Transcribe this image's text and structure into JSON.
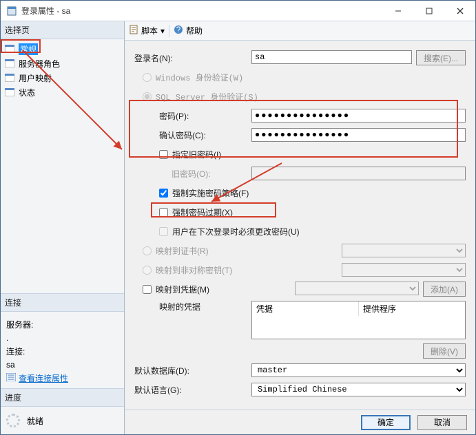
{
  "window": {
    "title": "登录属性 - sa"
  },
  "sidebar": {
    "header": "选择页",
    "items": [
      {
        "label": "常规"
      },
      {
        "label": "服务器角色"
      },
      {
        "label": "用户映射"
      },
      {
        "label": "状态"
      }
    ]
  },
  "connection": {
    "header": "连接",
    "server_label": "服务器:",
    "server_value": ".",
    "conn_label": "连接:",
    "conn_value": "sa",
    "view_link": "查看连接属性"
  },
  "progress": {
    "header": "进度",
    "status": "就绪"
  },
  "toolbar": {
    "script": "脚本",
    "help": "帮助"
  },
  "form": {
    "login_name_label": "登录名(N):",
    "login_name_value": "sa",
    "search_btn": "搜索(E)...",
    "auth_windows": "Windows 身份验证(W)",
    "auth_sql": "SQL Server 身份验证(S)",
    "password_label": "密码(P):",
    "password_value": "●●●●●●●●●●●●●●●",
    "confirm_label": "确认密码(C):",
    "confirm_value": "●●●●●●●●●●●●●●●",
    "specify_old_label": "指定旧密码(I)",
    "old_pw_label": "旧密码(O):",
    "enforce_policy_label": "强制实施密码策略(F)",
    "enforce_expire_label": "强制密码过期(X)",
    "must_change_label": "用户在下次登录时必须更改密码(U)",
    "map_cert_label": "映射到证书(R)",
    "map_asym_label": "映射到非对称密钥(T)",
    "map_cred_label": "映射到凭据(M)",
    "add_btn": "添加(A)",
    "mapped_cred_label": "映射的凭据",
    "th_cred": "凭据",
    "th_provider": "提供程序",
    "remove_btn": "删除(V)",
    "default_db_label": "默认数据库(D):",
    "default_db_value": "master",
    "default_lang_label": "默认语言(G):",
    "default_lang_value": "Simplified Chinese"
  },
  "footer": {
    "ok": "确定",
    "cancel": "取消"
  }
}
